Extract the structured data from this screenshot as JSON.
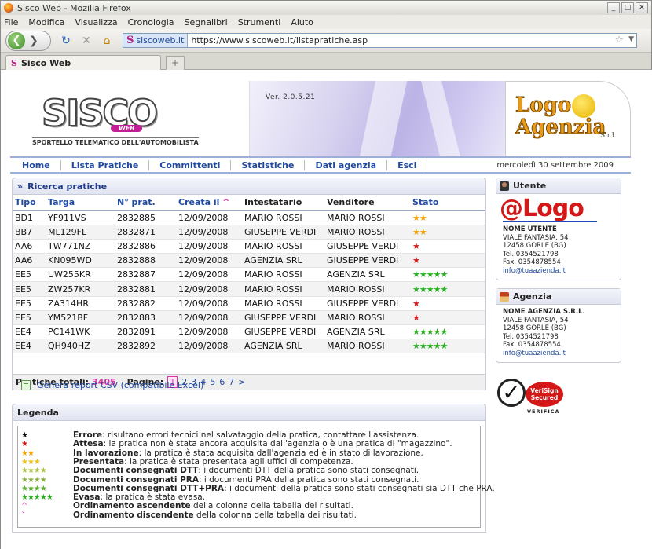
{
  "browser": {
    "window_title": "Sisco Web - Mozilla Firefox",
    "menu": [
      "File",
      "Modifica",
      "Visualizza",
      "Cronologia",
      "Segnalibri",
      "Strumenti",
      "Aiuto"
    ],
    "site_badge": "siscoweb.it",
    "url": "https://www.siscoweb.it/listapratiche.asp",
    "tab_title": "Sisco Web",
    "new_tab": "+"
  },
  "banner": {
    "logo_text": "SISCO",
    "logo_web": "WEB",
    "logo_subtitle": "SPORTELLO TELEMATICO DELL'AUTOMOBILISTA",
    "version": "Ver. 2.0.5.21",
    "agency_logo_line1": "Logo",
    "agency_logo_line2": "Agenzia",
    "agency_srl": "S.r.l."
  },
  "nav": {
    "items": [
      "Home",
      "Lista Pratiche",
      "Committenti",
      "Statistiche",
      "Dati agenzia",
      "Esci"
    ],
    "date": "mercoledì 30 settembre 2009"
  },
  "ricerca": {
    "title": "Ricerca pratiche",
    "columns": [
      "Tipo",
      "Targa",
      "N° prat.",
      "Creata il",
      "Intestatario",
      "Venditore",
      "Stato"
    ],
    "sort_indicator": "^",
    "rows": [
      [
        "BD1",
        "YF911VS",
        "2832885",
        "12/09/2008",
        "MARIO ROSSI",
        "MARIO ROSSI",
        "orange2"
      ],
      [
        "BB7",
        "ML129FL",
        "2832871",
        "12/09/2008",
        "GIUSEPPE VERDI",
        "MARIO ROSSI",
        "orange2"
      ],
      [
        "AA6",
        "TW771NZ",
        "2832886",
        "12/09/2008",
        "MARIO ROSSI",
        "GIUSEPPE VERDI",
        "red1"
      ],
      [
        "AA6",
        "KN095WD",
        "2832888",
        "12/09/2008",
        "AGENZIA SRL",
        "GIUSEPPE VERDI",
        "red1"
      ],
      [
        "EE5",
        "UW255KR",
        "2832887",
        "12/09/2008",
        "MARIO ROSSI",
        "AGENZIA SRL",
        "green5"
      ],
      [
        "EE5",
        "ZW257KR",
        "2832881",
        "12/09/2008",
        "MARIO ROSSI",
        "MARIO ROSSI",
        "green5"
      ],
      [
        "EE5",
        "ZA314HR",
        "2832882",
        "12/09/2008",
        "MARIO ROSSI",
        "GIUSEPPE VERDI",
        "red1"
      ],
      [
        "EE5",
        "YM521BF",
        "2832883",
        "12/09/2008",
        "GIUSEPPE VERDI",
        "MARIO ROSSI",
        "red1"
      ],
      [
        "EE4",
        "PC141WK",
        "2832891",
        "12/09/2008",
        "GIUSEPPE VERDI",
        "AGENZIA SRL",
        "green5"
      ],
      [
        "EE4",
        "QH940HZ",
        "2832892",
        "12/09/2008",
        "AGENZIA SRL",
        "MARIO ROSSI",
        "green5"
      ]
    ],
    "total_label": "Pratiche totali:",
    "total_value": "3405",
    "pages_label": "Pagine:",
    "pages": [
      "1",
      "2",
      "3",
      "4",
      "5",
      "6",
      "7",
      ">"
    ],
    "current_page": "1"
  },
  "csv_link": "Genera report CSV (compatibile Excel)",
  "legenda": {
    "title": "Legenda",
    "items": [
      {
        "bold": "Errore",
        "text": ": risultano errori tecnici nel salvataggio della pratica, contattare l'assistenza.",
        "icon": "black-star"
      },
      {
        "bold": "Attesa",
        "text": ": la pratica non è stata ancora acquisita dall'agenzia o è una pratica di \"magazzino\".",
        "icon": "red-star"
      },
      {
        "bold": "In lavorazione",
        "text": ": la pratica è stata acquisita dall'agenzia ed è in stato di lavorazione.",
        "icon": "orange-2-stars"
      },
      {
        "bold": "Presentata",
        "text": ": la pratica è stata presentata agli uffici di competenza.",
        "icon": "yellow-3-stars"
      },
      {
        "bold": "Documenti consegnati DTT",
        "text": ": i documenti DTT della pratica sono stati consegnati.",
        "icon": "dtt-4-stars"
      },
      {
        "bold": "Documenti consegnati PRA",
        "text": ": i documenti PRA della pratica sono stati consegnati.",
        "icon": "pra-4-stars"
      },
      {
        "bold": "Documenti consegnati DTT+PRA",
        "text": ": i documenti della pratica sono stati consegnati sia DTT che PRA.",
        "icon": "dttpra-4-stars"
      },
      {
        "bold": "Evasa",
        "text": ": la pratica è stata evasa.",
        "icon": "green-5-stars"
      },
      {
        "bold": "Ordinamento ascendente",
        "text": " della colonna della tabella dei risultati.",
        "icon": "sort-asc-icon"
      },
      {
        "bold": "Ordinamento discendente",
        "text": " della colonna della tabella dei risultati.",
        "icon": "sort-desc-icon"
      }
    ]
  },
  "utente": {
    "title": "Utente",
    "logo_at": "@",
    "logo_text": "Logo",
    "name": "NOME UTENTE",
    "address": "VIALE FANTASIA, 54",
    "city": "12458 GORLE (BG)",
    "tel": "Tel. 0354521798",
    "fax": "Fax. 0354878554",
    "email": "info@tuaazienda.it"
  },
  "agenzia": {
    "title": "Agenzia",
    "name": "NOME AGENZIA S.R.L.",
    "address": "VIALE FANTASIA, 54",
    "city": "12458 GORLE (BG)",
    "tel": "Tel. 0354521798",
    "fax": "Fax. 0354878554",
    "email": "info@tuaazienda.it"
  },
  "verisign": {
    "badge_line1": "VeriSign",
    "badge_line2": "Secured",
    "verify": "VERIFICA"
  }
}
